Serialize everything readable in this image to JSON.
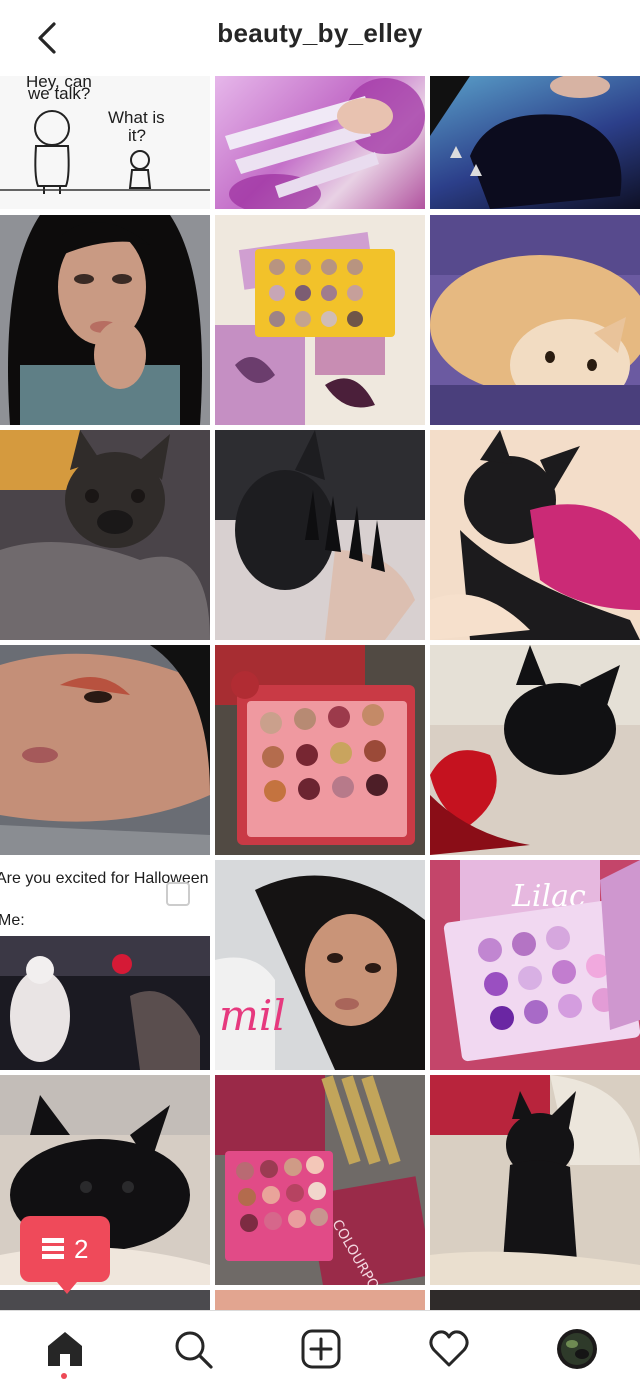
{
  "header": {
    "title": "beauty_by_elley"
  },
  "grid": {
    "tiles": [
      {
        "id": "comic",
        "lines": [
          "Hey, can",
          "we talk?",
          "What is",
          "it?"
        ]
      },
      {
        "id": "nails-lilac"
      },
      {
        "id": "black-bag"
      },
      {
        "id": "portrait-1"
      },
      {
        "id": "yellow-palette"
      },
      {
        "id": "orange-cat"
      },
      {
        "id": "frenchie-blanket"
      },
      {
        "id": "black-nails-bunny"
      },
      {
        "id": "frenchie-pink-shirt"
      },
      {
        "id": "portrait-eyeshadow"
      },
      {
        "id": "red-palette"
      },
      {
        "id": "frenchie-rose"
      },
      {
        "id": "halloween-meme",
        "lines": [
          "Are you excited for Halloween",
          "Me:"
        ]
      },
      {
        "id": "portrait-2"
      },
      {
        "id": "purple-palette",
        "brand": "Lilac"
      },
      {
        "id": "frenchie-lying"
      },
      {
        "id": "pink-palette-lipsticks",
        "brand": "COLOURPOP"
      },
      {
        "id": "frenchie-sitting"
      }
    ]
  },
  "notification": {
    "count": "2"
  },
  "bottom_nav": {
    "items": [
      "home",
      "search",
      "new-post",
      "activity",
      "profile"
    ]
  },
  "colors": {
    "notification_bg": "#ef4a5a",
    "title_text": "#262626",
    "icon": "#262626",
    "active_dot": "#ed4956"
  }
}
